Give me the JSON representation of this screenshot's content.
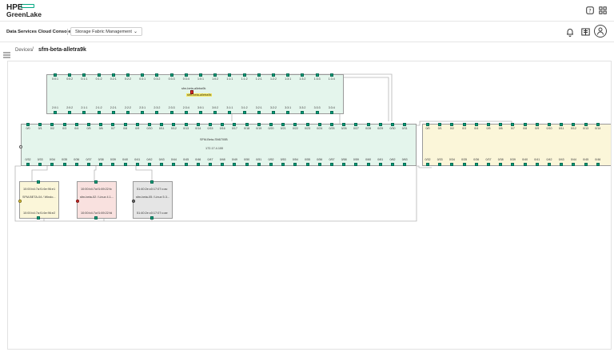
{
  "header": {
    "logo_line1": "HPE",
    "logo_line2": "GreenLake",
    "help_icon": "help-icon",
    "apps_icon": "apps-grid-icon"
  },
  "subheader": {
    "console_title": "Data Services Cloud Console",
    "service_selector": "Storage Fabric Management",
    "bell_icon": "bell-icon",
    "docs_icon": "docs-icon",
    "avatar_icon": "user-avatar-icon"
  },
  "breadcrumb": {
    "parent": "Devices",
    "separator": "/",
    "current": "sfm-beta-alletra9k"
  },
  "topology": {
    "switch_top": {
      "name": "sfm-beta-alletra9k",
      "tooltip": "sfm-beta-alletra9k",
      "top_ports": [
        "0:0:1",
        "0:0:2",
        "0:1:1",
        "0:1:2",
        "0:2:1",
        "0:2:2",
        "0:3:1",
        "0:3:2",
        "0:3:3",
        "0:3:4",
        "1:0:1",
        "1:0:2",
        "1:1:1",
        "1:1:2",
        "1:2:1",
        "1:2:2",
        "1:3:1",
        "1:3:2",
        "1:3:3",
        "1:3:4"
      ],
      "bottom_ports": [
        "2:0:1",
        "2:0:2",
        "2:1:1",
        "2:1:2",
        "2:2:1",
        "2:2:2",
        "2:3:1",
        "2:3:2",
        "2:3:3",
        "2:3:4",
        "3:0:1",
        "3:0:2",
        "3:1:1",
        "3:1:2",
        "3:2:1",
        "3:2:2",
        "3:3:1",
        "3:3:2",
        "3:3:3",
        "3:3:4"
      ]
    },
    "switch_mid": {
      "name": "SFM-Beta-SN6700B",
      "ip": "172.17.4.100",
      "top_ports": [
        "0/0",
        "0/1",
        "0/2",
        "0/3",
        "0/4",
        "0/5",
        "0/6",
        "0/7",
        "0/8",
        "0/9",
        "0/10",
        "0/11",
        "0/12",
        "0/13",
        "0/14",
        "0/15",
        "0/16",
        "0/17",
        "0/18",
        "0/19",
        "0/20",
        "0/21",
        "0/22",
        "0/23",
        "0/24",
        "0/25",
        "0/26",
        "0/27",
        "0/28",
        "0/29",
        "0/30",
        "0/31"
      ],
      "bottom_ports": [
        "0/32",
        "0/33",
        "0/34",
        "0/35",
        "0/36",
        "0/37",
        "0/38",
        "0/39",
        "0/40",
        "0/41",
        "0/42",
        "0/43",
        "0/44",
        "0/45",
        "0/46",
        "0/47",
        "0/48",
        "0/49",
        "0/50",
        "0/51",
        "0/52",
        "0/53",
        "0/54",
        "0/55",
        "0/56",
        "0/57",
        "0/58",
        "0/59",
        "0/60",
        "0/61",
        "0/62",
        "0/63"
      ]
    },
    "switch_right": {
      "top_ports": [
        "0/0",
        "0/1",
        "0/2",
        "0/3",
        "0/4",
        "0/5",
        "0/6",
        "0/7",
        "0/8",
        "0/9",
        "0/10",
        "0/11",
        "0/12",
        "0/13",
        "0/14"
      ],
      "bottom_ports": [
        "0/32",
        "0/33",
        "0/34",
        "0/35",
        "0/36",
        "0/37",
        "0/38",
        "0/39",
        "0/40",
        "0/41",
        "0/42",
        "0/43",
        "0/44",
        "0/45",
        "0/46"
      ]
    },
    "hosts": [
      {
        "wwn_top": "10:00:b4:7a:f1:6e:96:e1",
        "name": "SFM-BETA-04 / Windo...",
        "wwn_bottom": "10:00:b4:7a:f1:6e:96:e2",
        "color": "#fbf6d9"
      },
      {
        "wwn_top": "10:00:b4:7a:f1:69:22:fc",
        "name": "sfm-beta-02 / Linux 4.1...",
        "wwn_bottom": "10:00:b4:7a:f1:69:22:fd",
        "color": "#f9e1df"
      },
      {
        "wwn_top": "51:40:2e:c0:17:07:c:ac",
        "name": "sfm-beta-05 / Linux 5.3...",
        "wwn_bottom": "51:40:2e:c0:17:07:c:ae",
        "color": "#e5e5e5"
      }
    ]
  },
  "colors": {
    "accent": "#01a982",
    "port_active": "#069e7a",
    "switch_green": "#e4f5ec",
    "switch_yellow": "#fbf6d9"
  }
}
